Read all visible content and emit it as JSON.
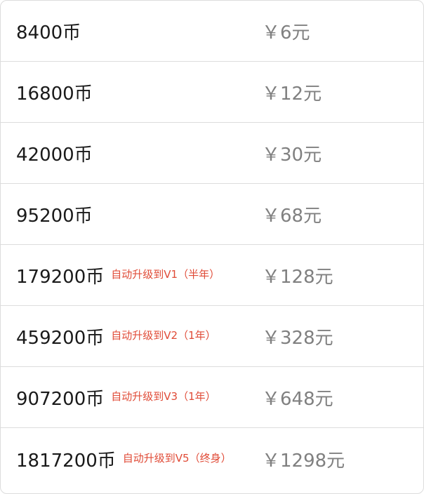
{
  "packages": [
    {
      "coins": "8400币",
      "note": "",
      "price": "￥6元"
    },
    {
      "coins": "16800币",
      "note": "",
      "price": "￥12元"
    },
    {
      "coins": "42000币",
      "note": "",
      "price": "￥30元"
    },
    {
      "coins": "95200币",
      "note": "",
      "price": "￥68元"
    },
    {
      "coins": "179200币",
      "note": "自动升级到V1（半年）",
      "price": "￥128元"
    },
    {
      "coins": "459200币",
      "note": "自动升级到V2（1年）",
      "price": "￥328元"
    },
    {
      "coins": "907200币",
      "note": "自动升级到V3（1年）",
      "price": "￥648元"
    },
    {
      "coins": "1817200币",
      "note": "自动升级到V5（终身）",
      "price": "￥1298元"
    }
  ],
  "colors": {
    "coins_text": "#1a1a1a",
    "note_text": "#e04b37",
    "price_text": "#808080",
    "divider": "#dddddd"
  }
}
